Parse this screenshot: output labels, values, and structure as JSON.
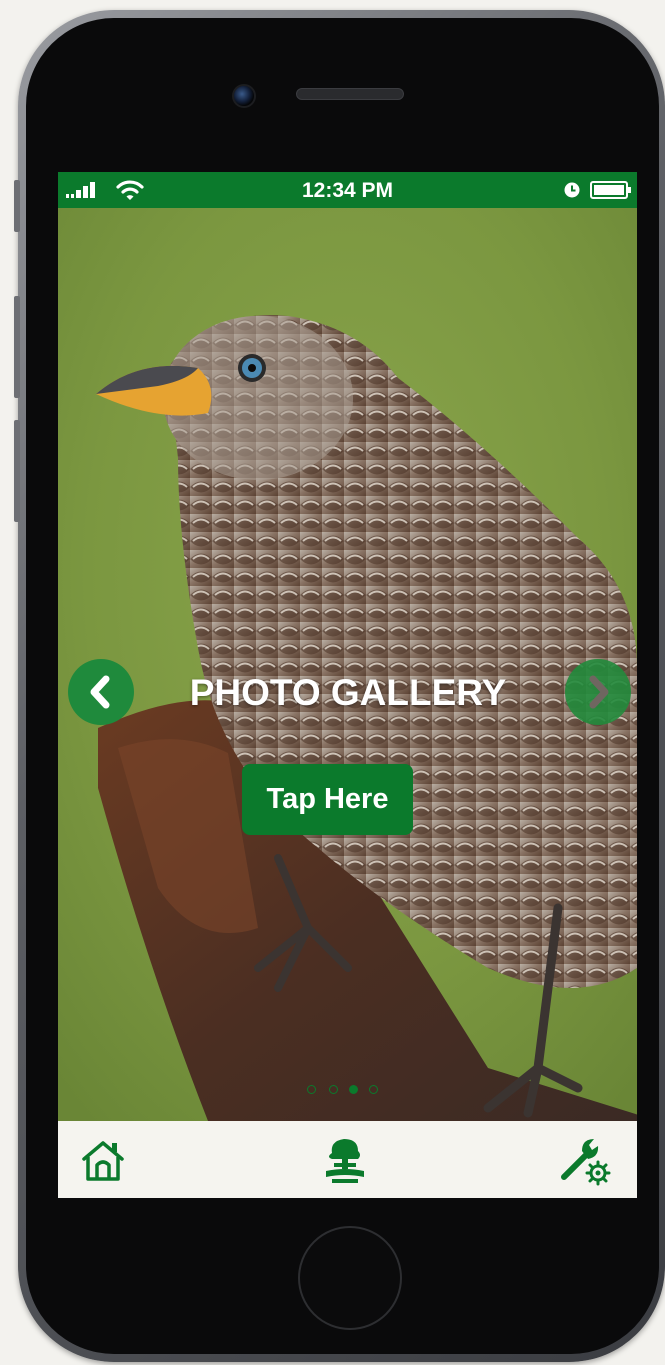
{
  "status_bar": {
    "time": "12:34 PM",
    "icons": [
      "signal-bars-icon",
      "wifi-icon",
      "alarm-clock-icon",
      "battery-icon"
    ]
  },
  "gallery": {
    "title": "PHOTO GALLERY",
    "cta_label": "Tap Here",
    "slide_count": 4,
    "active_slide": 3
  },
  "tab_bar": {
    "items": [
      {
        "icon": "home-icon"
      },
      {
        "icon": "tree-logo-icon"
      },
      {
        "icon": "wrench-gear-settings-icon"
      }
    ]
  },
  "colors": {
    "brand_green": "#0b7a2c",
    "tab_bar_bg": "#f5f4ef",
    "photo_background": "#7b9a45"
  }
}
